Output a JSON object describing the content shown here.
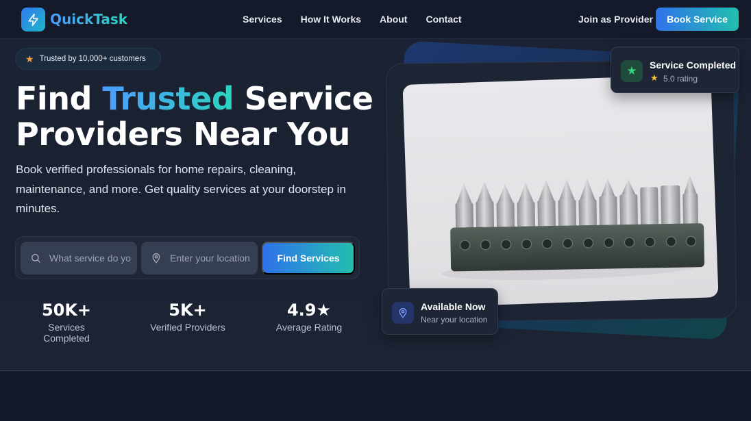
{
  "brand": {
    "name": "QuickTask",
    "logo_icon": "lightning-bolt-icon",
    "accent_start": "#2f7bf0",
    "accent_end": "#1fb5c9"
  },
  "nav": {
    "links": [
      "Services",
      "How It Works",
      "About",
      "Contact"
    ],
    "join_label": "Join as Provider",
    "book_label": "Book Service"
  },
  "hero": {
    "badge": {
      "icon": "star-icon",
      "text": "Trusted by 10,000+ customers"
    },
    "headline_part1": "Find ",
    "headline_accent": "Trusted",
    "headline_part2": " Service Providers Near You",
    "subtext": "Book verified professionals for home repairs, cleaning, maintenance, and more. Get quality services at your doorstep in minutes.",
    "search": {
      "service_placeholder": "What service do you need?",
      "location_placeholder": "Enter your location",
      "button_label": "Find Services"
    },
    "stats": [
      {
        "value": "50K+",
        "label": "Services Completed"
      },
      {
        "value": "5K+",
        "label": "Verified Providers"
      },
      {
        "value": "4.9★",
        "label": "Average Rating"
      }
    ]
  },
  "cards": {
    "completed": {
      "title": "Service Completed",
      "rating_icon": "star-icon",
      "rating_text": "5.0 rating"
    },
    "available": {
      "title": "Available Now",
      "subtitle": "Near your location"
    }
  }
}
